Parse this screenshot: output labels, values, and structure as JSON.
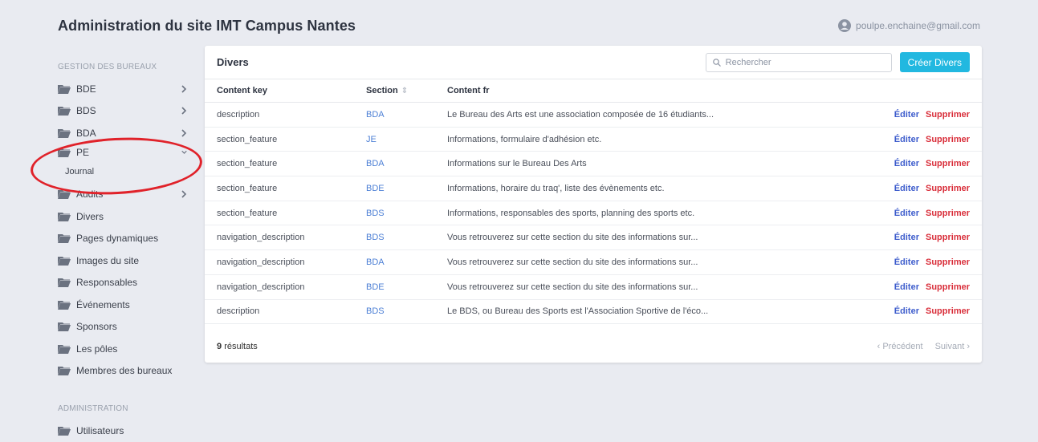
{
  "header": {
    "site_title": "Administration du site IMT Campus Nantes",
    "user_email": "poulpe.enchaine@gmail.com"
  },
  "sidebar": {
    "section_bureaux": "GESTION DES BUREAUX",
    "items": [
      {
        "label": "BDE"
      },
      {
        "label": "BDS"
      },
      {
        "label": "BDA"
      },
      {
        "label": "PE"
      },
      {
        "label": "Journal"
      },
      {
        "label": "Audits"
      },
      {
        "label": "Divers"
      },
      {
        "label": "Pages dynamiques"
      },
      {
        "label": "Images du site"
      },
      {
        "label": "Responsables"
      },
      {
        "label": "Événements"
      },
      {
        "label": "Sponsors"
      },
      {
        "label": "Les pôles"
      },
      {
        "label": "Membres des bureaux"
      }
    ],
    "section_admin": "ADMINISTRATION",
    "admin_items": [
      {
        "label": "Utilisateurs"
      }
    ]
  },
  "card": {
    "title": "Divers",
    "search_placeholder": "Rechercher",
    "create_label": "Créer Divers",
    "columns": [
      "Content key",
      "Section",
      "Content fr"
    ],
    "rows": [
      {
        "key": "description",
        "section": "BDA",
        "content": "Le Bureau des Arts est une association composée de 16 étudiants..."
      },
      {
        "key": "section_feature",
        "section": "JE",
        "content": "Informations, formulaire d'adhésion etc."
      },
      {
        "key": "section_feature",
        "section": "BDA",
        "content": "Informations sur le Bureau Des Arts"
      },
      {
        "key": "section_feature",
        "section": "BDE",
        "content": "Informations, horaire du traq', liste des évènements etc."
      },
      {
        "key": "section_feature",
        "section": "BDS",
        "content": "Informations, responsables des sports, planning des sports etc."
      },
      {
        "key": "navigation_description",
        "section": "BDS",
        "content": "Vous retrouverez sur cette section du site des informations sur..."
      },
      {
        "key": "navigation_description",
        "section": "BDA",
        "content": "Vous retrouverez sur cette section du site des informations sur..."
      },
      {
        "key": "navigation_description",
        "section": "BDE",
        "content": "Vous retrouverez sur cette section du site des informations sur..."
      },
      {
        "key": "description",
        "section": "BDS",
        "content": "Le BDS, ou Bureau des Sports est l'Association Sportive de l'éco..."
      }
    ],
    "edit_label": "Éditer",
    "delete_label": "Supprimer",
    "results_count": "9",
    "results_label": "résultats",
    "prev_label": "‹ Précédent",
    "next_label": "Suivant ›"
  }
}
